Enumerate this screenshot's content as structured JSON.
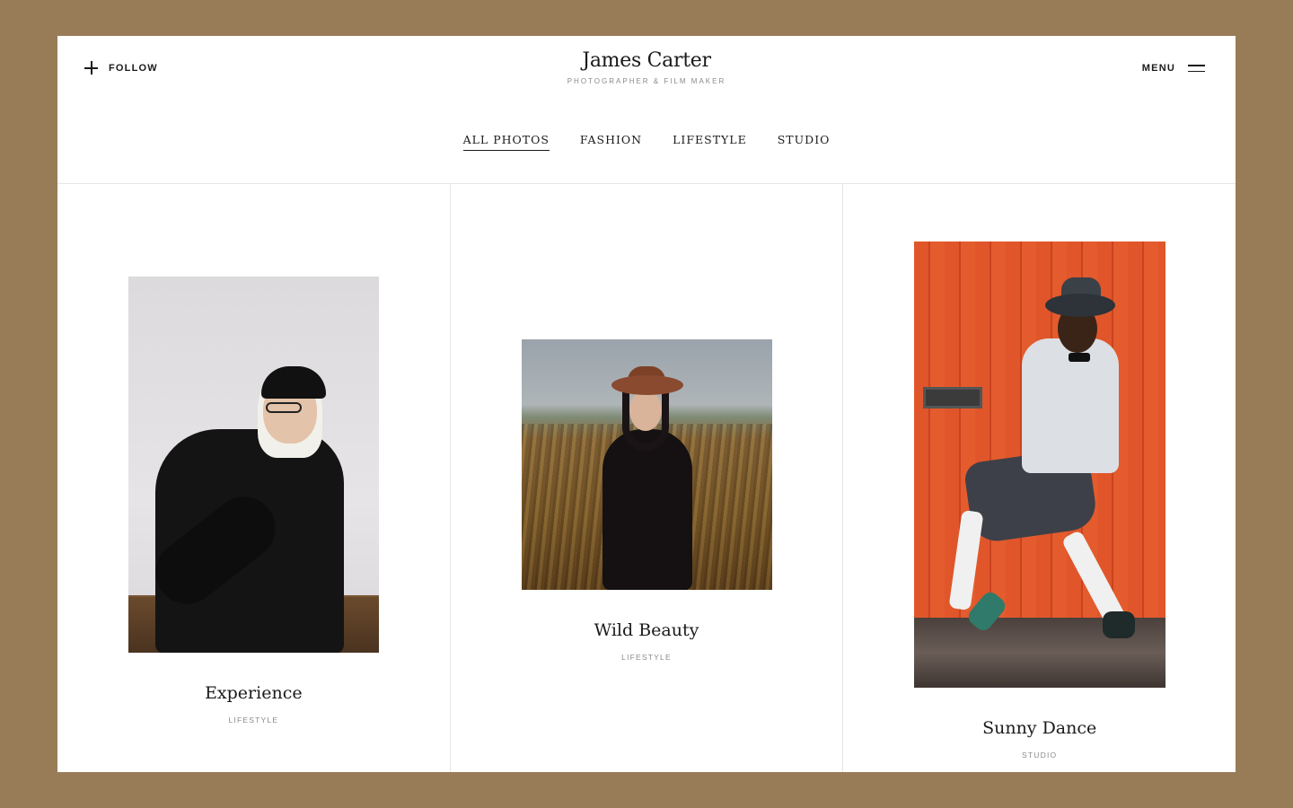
{
  "header": {
    "follow_label": "FOLLOW",
    "brand_name": "James Carter",
    "brand_tagline": "PHOTOGRAPHER & FILM MAKER",
    "menu_label": "MENU"
  },
  "filters": [
    {
      "label": "ALL PHOTOS",
      "active": true
    },
    {
      "label": "FASHION",
      "active": false
    },
    {
      "label": "LIFESTYLE",
      "active": false
    },
    {
      "label": "STUDIO",
      "active": false
    }
  ],
  "gallery": [
    {
      "title": "Experience",
      "category": "LIFESTYLE"
    },
    {
      "title": "Wild Beauty",
      "category": "LIFESTYLE"
    },
    {
      "title": "Sunny Dance",
      "category": "STUDIO"
    }
  ],
  "colors": {
    "page_background": "#987c58",
    "panel_background": "#ffffff",
    "text": "#1a1a1a",
    "muted_text": "#8a8a8a"
  },
  "icons": {
    "follow": "plus-icon",
    "menu": "hamburger-menu-icon"
  }
}
